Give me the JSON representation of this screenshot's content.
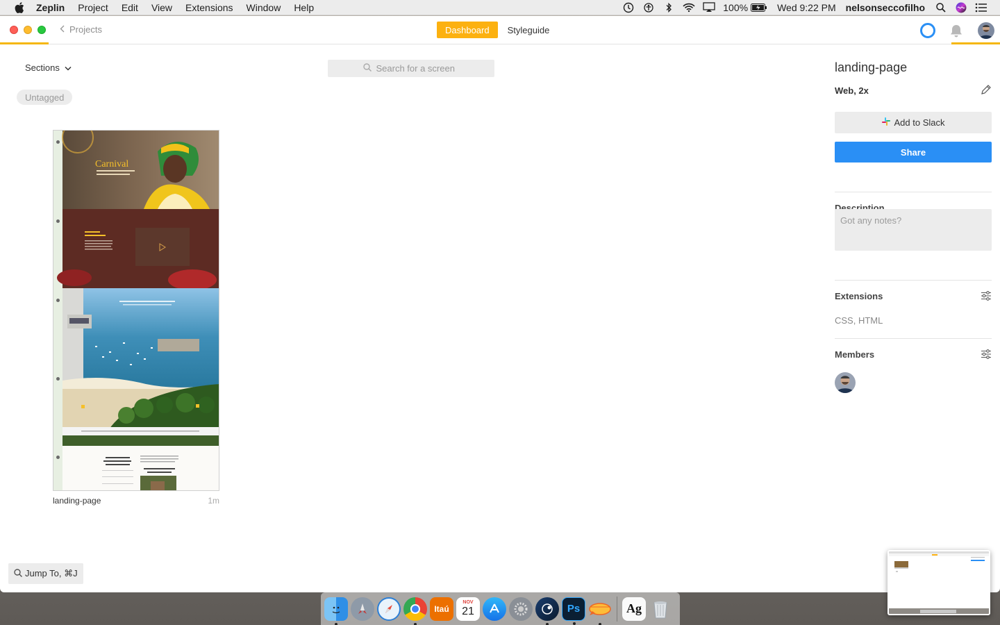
{
  "menubar": {
    "app_name": "Zeplin",
    "menus": [
      "Project",
      "Edit",
      "View",
      "Extensions",
      "Window",
      "Help"
    ],
    "battery": "100%",
    "datetime": "Wed 9:22 PM",
    "username": "nelsonseccofilho"
  },
  "titlebar": {
    "back_label": "Projects",
    "tabs": [
      "Dashboard",
      "Styleguide"
    ],
    "active_tab": "Dashboard"
  },
  "main": {
    "sections_label": "Sections",
    "search_placeholder": "Search for a screen",
    "tag_label": "Untagged",
    "screens": [
      {
        "name": "landing-page",
        "time": "1m"
      }
    ],
    "jump_to_label": "Jump To, ⌘J"
  },
  "sidebar": {
    "screen_title": "landing-page",
    "platform": "Web, 2x",
    "slack_button": "Add to Slack",
    "share_button": "Share",
    "description_heading": "Description",
    "description_placeholder": "Got any notes?",
    "extensions_heading": "Extensions",
    "extensions_value": "CSS, HTML",
    "members_heading": "Members"
  },
  "colors": {
    "accent": "#fcb110",
    "primary": "#2a8ff5"
  },
  "dock": {
    "apps": [
      "finder-icon",
      "launchpad-icon",
      "safari-icon",
      "chrome-icon",
      "itau-icon",
      "calendar-icon",
      "app-store-icon",
      "system-preferences-icon",
      "steam-icon",
      "photoshop-icon",
      "zeplin-icon",
      "font-book-icon",
      "trash-icon"
    ],
    "itau_label": "Itaú",
    "calendar_month": "NOV",
    "calendar_day": "21",
    "photoshop_label": "Ps",
    "fontbook_label": "Ag"
  }
}
